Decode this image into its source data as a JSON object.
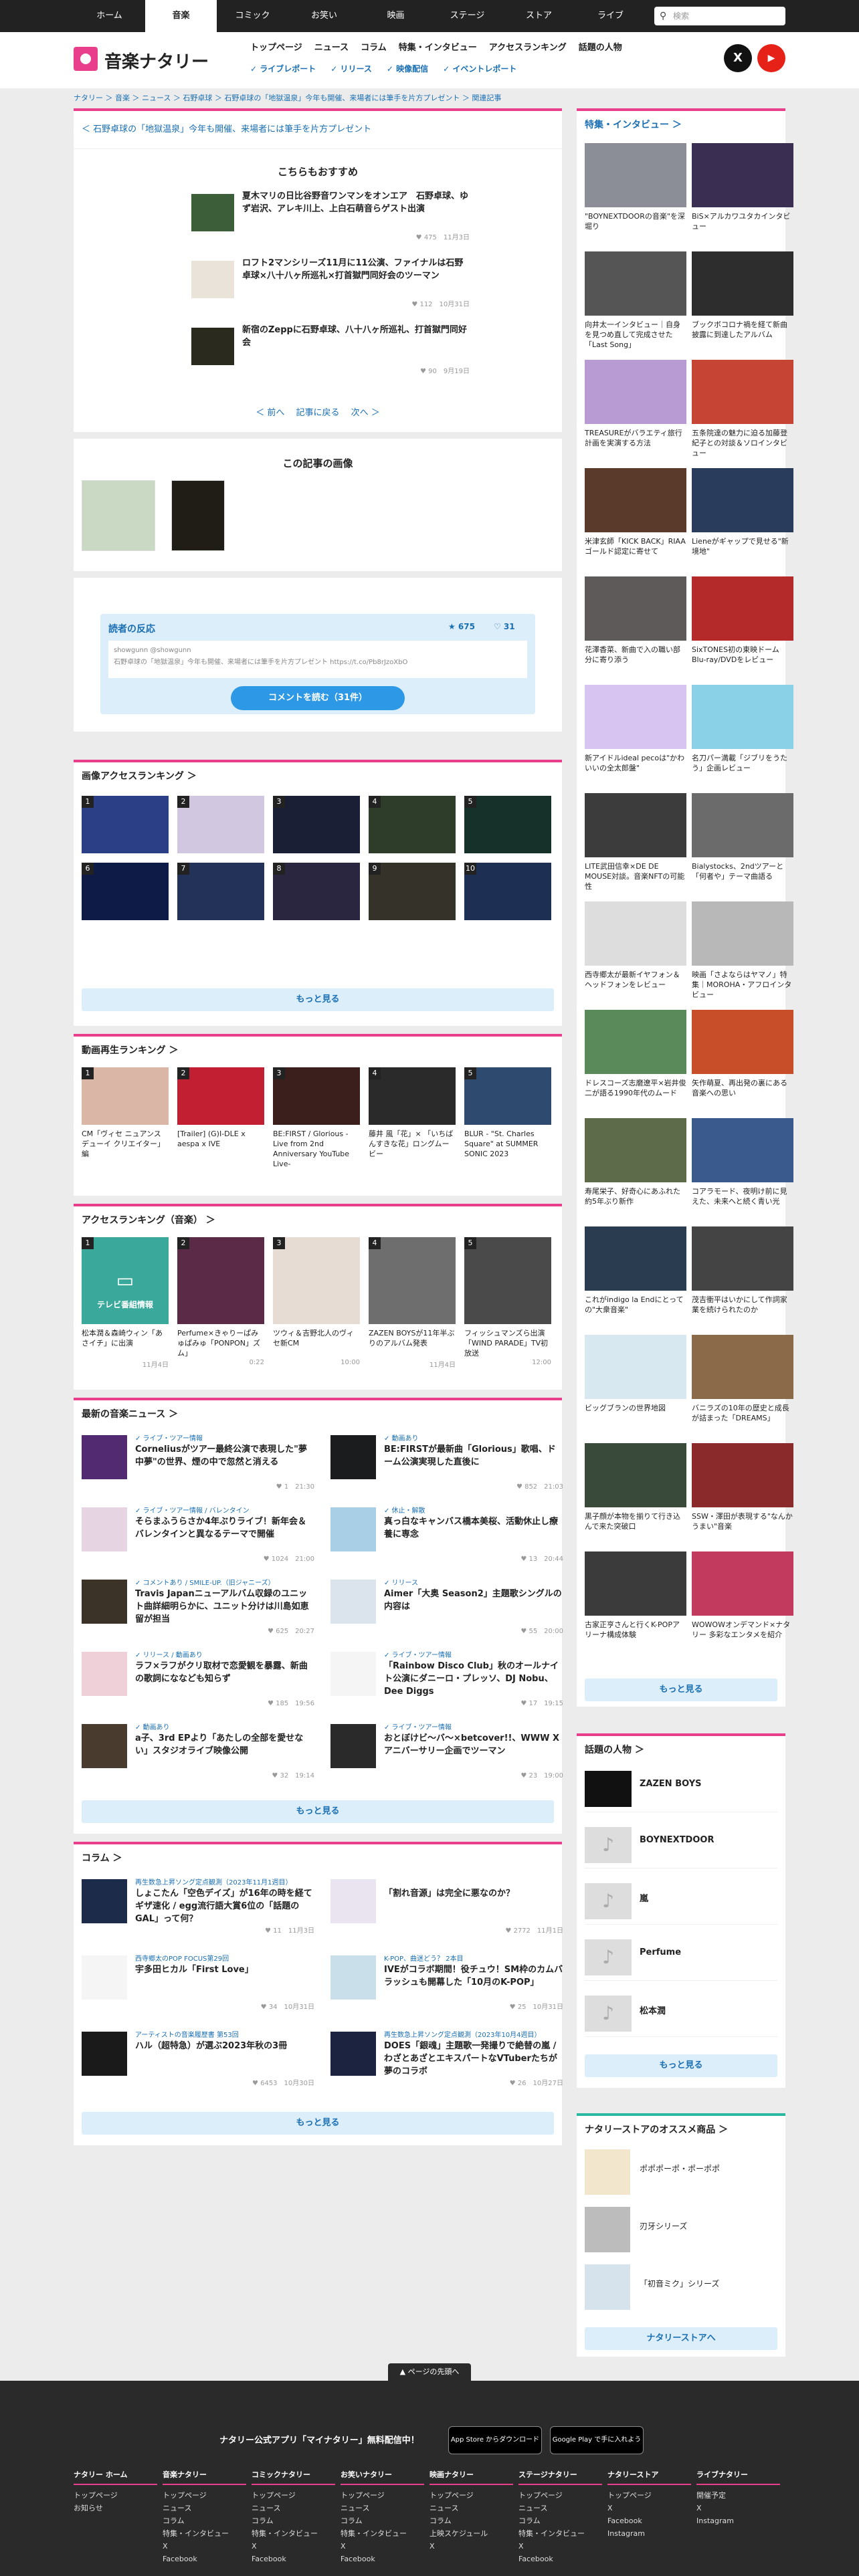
{
  "topnav": {
    "items": [
      "ホーム",
      "音楽",
      "コミック",
      "お笑い",
      "映画",
      "ステージ",
      "ストア",
      "ライブ"
    ],
    "search_placeholder": "検索"
  },
  "header": {
    "logo": "音楽ナタリー",
    "nav": [
      "トップページ",
      "ニュース",
      "コラム",
      "特集・インタビュー",
      "アクセスランキング",
      "話題の人物"
    ],
    "sub": [
      "ライブレポート",
      "リリース",
      "映像配信",
      "イベントレポート"
    ],
    "x": "X",
    "yt": "▶"
  },
  "breadcrumb": "ナタリー ＞ 音楽 ＞ ニュース ＞ 石野卓球 ＞ 石野卓球の「地獄温泉」今年も開催、来場者には筆手を片方プレゼント ＞ 関連記事",
  "article": {
    "prev_link": "石野卓球の「地獄温泉」今年も開催、来場者には筆手を片方プレゼント",
    "rec_title": "こちらもおすすめ",
    "rec": [
      {
        "title": "夏木マリの日比谷野音ワンマンをオンエア　石野卓球、ゆず岩沢、アレキ川上、上白石萌音らゲスト出演",
        "meta": "♥ 475　11月3日"
      },
      {
        "title": "ロフト2マンシリーズ11月に11公演、ファイナルは石野卓球×八十八ヶ所巡礼×打首獄門同好会のツーマン",
        "meta": "♥ 112　10月31日"
      },
      {
        "title": "新宿のZeppに石野卓球、八十八ヶ所巡礼、打首獄門同好会",
        "meta": "♥ 90　9月19日"
      }
    ],
    "pager": {
      "prev": "＜ 前へ",
      "back": "記事に戻る",
      "next": "次へ ＞"
    },
    "images_title": "この記事の画像",
    "reaction": {
      "title": "読者の反応",
      "likes": "★ 675",
      "comments": "♡ 31",
      "user": "showgunn @showgunn",
      "text": "石野卓球の「地獄温泉」今年も開催、来場者には筆手を片方プレゼント https://t.co/Pb8rJzoXbO",
      "button": "コメントを読む（31件）"
    }
  },
  "img_rank": {
    "title": "画像アクセスランキング ＞",
    "more": "もっと見る"
  },
  "video_rank": {
    "title": "動画再生ランキング ＞",
    "items": [
      {
        "cap": "CM「ヴィセ ニュアンス デューイ クリエイター」編"
      },
      {
        "cap": "[Trailer] (G)I-DLE x aespa x IVE"
      },
      {
        "cap": "BE:FIRST / Glorious -Live from 2nd Anniversary YouTube Live-"
      },
      {
        "cap": "藤井 風「花」× 「いちばんすきな花」ロングムービー"
      },
      {
        "cap": "BLUR - \"St. Charles Square\" at SUMMER SONIC 2023"
      }
    ]
  },
  "access_rank": {
    "title": "アクセスランキング（音楽） ＞",
    "items": [
      {
        "cap": "松本潤＆森崎ウィン「あさイチ」に出演",
        "time": "11月4日",
        "badge": "テレビ番組情報"
      },
      {
        "cap": "Perfume×きゃりーぱみゅぱみゅ「PONPON」ズム」",
        "time": "0:22"
      },
      {
        "cap": "ツウィ＆吉野北人のヴィセ新CM",
        "time": "10:00"
      },
      {
        "cap": "ZAZEN BOYSが11年半ぶりのアルバム発表",
        "time": "11月4日"
      },
      {
        "cap": "フィッシュマンズら出演「WIND PARADE」TV初放送",
        "time": "12:00"
      }
    ]
  },
  "latest": {
    "title": "最新の音楽ニュース ＞",
    "more": "もっと見る",
    "items": [
      {
        "cat": "✓ ライブ・ツアー情報",
        "title": "Corneliusがツアー最終公演で表現した\"夢中夢\"の世界、煙の中で忽然と消える",
        "meta": "♥ 1　21:30"
      },
      {
        "cat": "✓ 動画あり",
        "title": "BE:FIRSTが最新曲「Glorious」歌唱、ドーム公演実現した直後に",
        "meta": "♥ 852　21:03"
      },
      {
        "cat": "✓ ライブ・ツアー情報 / バレンタイン",
        "title": "そらまふうらさか4年ぶりライブ！新年会＆バレンタインと異なるテーマで開催",
        "meta": "♥ 1024　21:00"
      },
      {
        "cat": "✓ 休止・解散",
        "title": "真っ白なキャンバス橋本美桜、活動休止し療養に専念",
        "meta": "♥ 13　20:44"
      },
      {
        "cat": "✓ コメントあり / SMILE-UP.（旧ジャニーズ）",
        "title": "Travis Japanニューアルバム収録のユニット曲詳細明らかに、ユニット分けは川島如恵留が担当",
        "meta": "♥ 625　20:27"
      },
      {
        "cat": "✓ リリース",
        "title": "Aimer「大奥 Season2」主題歌シングルの内容は",
        "meta": "♥ 55　20:00"
      },
      {
        "cat": "✓ リリース / 動画あり",
        "title": "ラフ×ラフがクリ取材で恋愛観を暴露、新曲の歌詞にななども知らず",
        "meta": "♥ 185　19:56"
      },
      {
        "cat": "✓ ライブ・ツアー情報",
        "title": "「Rainbow Disco Club」秋のオールナイト公演にダニーロ・プレッソ、DJ Nobu、Dee Diggs",
        "meta": "♥ 17　19:15"
      },
      {
        "cat": "✓ 動画あり",
        "title": "a子、3rd EPより「あたしの全部を愛せない」スタジオライブ映像公開",
        "meta": "♥ 32　19:14"
      },
      {
        "cat": "✓ ライブ・ツアー情報",
        "title": "おとぼけビ～バ～×betcover!!、WWW Xアニバーサリー企画でツーマン",
        "meta": "♥ 23　19:00"
      }
    ]
  },
  "column": {
    "title": "コラム ＞",
    "more": "もっと見る",
    "items": [
      {
        "cat": "再生数急上昇ソング定点観測（2023年11月1週目）",
        "title": "しょこたん「空色デイズ」が16年の時を経てギザ速化 / egg流行語大賞6位の「話題のGAL」って何？",
        "meta": "♥ 11　11月3日"
      },
      {
        "cat": "",
        "title": "「割れ音源」は完全に悪なのか？",
        "meta": "♥ 2772　11月1日"
      },
      {
        "cat": "西寺郷太のPOP FOCUS第29回",
        "title": "宇多田ヒカル「First Love」",
        "meta": "♥ 34　10月31日"
      },
      {
        "cat": "K-POP、曲迷どう？ 2本目",
        "title": "IVEがコラボ期間！役チュウ！SM枠のカムバラッシュも開幕した「10月のK-POP」",
        "meta": "♥ 25　10月31日"
      },
      {
        "cat": "アーティストの音楽履歴書 第53回",
        "title": "ハル（超特急）が選ぶ2023年秋の3冊",
        "meta": "♥ 6453　10月30日"
      },
      {
        "cat": "再生数急上昇ソング定点観測（2023年10月4週目）",
        "title": "DOES「銀魂」主題歌一発撮りで絶替の嵐 / わざとあざとエキスパートなVTuberたちが夢のコラボ",
        "meta": "♥ 26　10月27日"
      }
    ]
  },
  "side_special": {
    "title": "特集・インタビュー ＞",
    "more": "もっと見る",
    "items": [
      "\"BOYNEXTDOORの音楽\"を深堀り",
      "BiS×アルカワユタカインタビュー",
      "向井太一インタビュー｜自身を見つめ直して完成させた「Last Song」",
      "ブックボコロナ禍を経て新曲披露に到達したアルバム",
      "TREASUREがバラエティ旅行計画を実演する方法",
      "五条院達の魅力に迫る加藤登紀子との対談＆ソロインタビュー",
      "米津玄師「KICK BACK」RIAAゴールド認定に寄せて",
      "Lieneがギャップで見せる\"新境地\"",
      "花澤香菜、新曲で入の職い部分に寄り添う",
      "SixTONES初の東映ドームBlu-ray/DVDをレビュー",
      "新アイドルideal pecoは\"かわいいの全太郎盤\"",
      "名刀パー満載「ジブリをうたう」企画レビュー",
      "LITE武田信幸×DE DE MOUSE対談。音楽NFTの可能性",
      "Bialystocks、2ndツアーと「何者や」テーマ曲語る",
      "西寺郷太が最新イヤフォン＆ヘッドフォンをレビュー",
      "映画「さよならはヤマノ」特集｜MOROHA・アフロインタビュー",
      "ドレスコーズ志磨遼平×岩井俊二が語る1990年代のムード",
      "矢作萌夏、再出発の裏にある音楽への思い",
      "寿尾栄子、好奇心にあふれた約5年ぶり新作",
      "コアラモード、夜明け前に見えた、未来へと続く青い光",
      "これがindigo la Endにとっての\"大衆音楽\"",
      "茂吉衝平はいかにして作詞家業を続けられたのか",
      "ビッグブランの世界地図",
      "バニラズの10年の歴史と成長が詰まった「DREAMS」",
      "黒子顔が本物を揃りて行き込んで来た突破口",
      "SSW・澤田が表現する\"なんかうまい\"音楽",
      "古家正亨さんと行くK-POPアリーナ構成体験",
      "WOWOWオンデマンド×ナタリー 多彩なエンタメを紹介"
    ]
  },
  "people": {
    "title": "話題の人物 ＞",
    "more": "もっと見る",
    "items": [
      "ZAZEN BOYS",
      "BOYNEXTDOOR",
      "嵐",
      "Perfume",
      "松本潤"
    ]
  },
  "store": {
    "title": "ナタリーストアのオススメ商品 ＞",
    "more": "ナタリーストアへ",
    "items": [
      "ポポポーポ・ポーポポ",
      "刃牙シリーズ",
      "「初音ミク」シリーズ"
    ],
    "label1": "ポポポーポ・ポーポポ"
  },
  "footer": {
    "pagetop": "▲ ページの先頭へ",
    "app_text": "ナタリー公式アプリ「マイナタリー」無料配信中！",
    "appstore": "App Store からダウンロード",
    "googleplay": "Google Play で手に入れよう",
    "cols": [
      {
        "h": "ナタリー ホーム",
        "items": [
          "トップページ",
          "お知らせ"
        ]
      },
      {
        "h": "音楽ナタリー",
        "items": [
          "トップページ",
          "ニュース",
          "コラム",
          "特集・インタビュー",
          "X",
          "Facebook"
        ]
      },
      {
        "h": "コミックナタリー",
        "items": [
          "トップページ",
          "ニュース",
          "コラム",
          "特集・インタビュー",
          "X",
          "Facebook"
        ]
      },
      {
        "h": "お笑いナタリー",
        "items": [
          "トップページ",
          "ニュース",
          "コラム",
          "特集・インタビュー",
          "X",
          "Facebook"
        ]
      },
      {
        "h": "映画ナタリー",
        "items": [
          "トップページ",
          "ニュース",
          "コラム",
          "上映スケジュール",
          "X"
        ]
      },
      {
        "h": "ステージナタリー",
        "items": [
          "トップページ",
          "ニュース",
          "コラム",
          "特集・インタビュー",
          "X",
          "Facebook"
        ]
      },
      {
        "h": "ナタリーストア",
        "items": [
          "トップページ",
          "X",
          "Facebook",
          "Instagram"
        ]
      },
      {
        "h": "ライブナタリー",
        "items": [
          "開催予定",
          "X",
          "Instagram"
        ]
      }
    ]
  },
  "colors": {
    "accent": "#e83e8c",
    "link": "#1a6fb3",
    "topbar": "#222222"
  }
}
